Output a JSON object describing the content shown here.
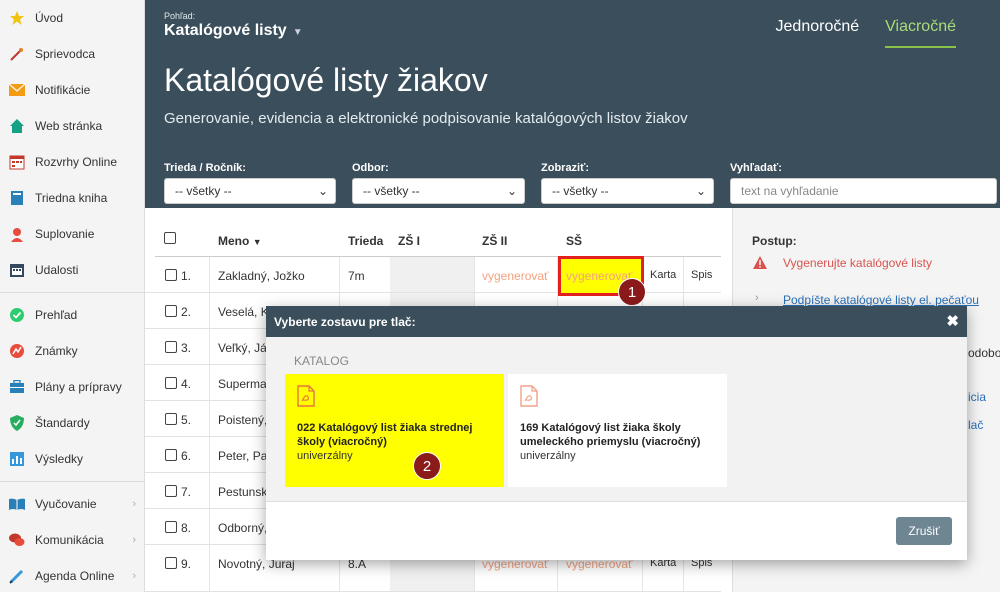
{
  "sidebar": {
    "items": [
      {
        "label": "Úvod",
        "icon": "star-icon"
      },
      {
        "label": "Sprievodca",
        "icon": "magic-wand-icon"
      },
      {
        "label": "Notifikácie",
        "icon": "envelope-icon"
      },
      {
        "label": "Web stránka",
        "icon": "house-icon"
      },
      {
        "label": "Rozvrhy Online",
        "icon": "calendar-grid-icon"
      },
      {
        "label": "Triedna kniha",
        "icon": "book-icon"
      },
      {
        "label": "Suplovanie",
        "icon": "user-icon"
      },
      {
        "label": "Udalosti",
        "icon": "calendar-icon"
      },
      {
        "label": "Prehľad",
        "icon": "check-circle-icon"
      },
      {
        "label": "Známky",
        "icon": "chart-circle-icon"
      },
      {
        "label": "Plány a prípravy",
        "icon": "briefcase-icon"
      },
      {
        "label": "Štandardy",
        "icon": "shield-icon"
      },
      {
        "label": "Výsledky",
        "icon": "bar-chart-icon"
      },
      {
        "label": "Vyučovanie",
        "icon": "open-book-icon"
      },
      {
        "label": "Komunikácia",
        "icon": "chat-bubbles-icon"
      },
      {
        "label": "Agenda Online",
        "icon": "pen-icon"
      }
    ]
  },
  "header": {
    "view_label": "Pohľad:",
    "view_value": "Katalógové listy",
    "tabs": [
      "Jednoročné",
      "Viacročné"
    ],
    "active_tab": "Viacročné",
    "title": "Katalógové listy žiakov",
    "subtitle": "Generovanie, evidencia a elektronické podpisovanie katalógových listov žiakov"
  },
  "filters": {
    "trieda": {
      "label": "Trieda / Ročník:",
      "value": "-- všetky --"
    },
    "odbor": {
      "label": "Odbor:",
      "value": "-- všetky --"
    },
    "zobrazit": {
      "label": "Zobraziť:",
      "value": "-- všetky --"
    },
    "vyhladat": {
      "label": "Vyhľadať:",
      "placeholder": "text na vyhľadanie"
    }
  },
  "table": {
    "columns": {
      "meno": "Meno",
      "trieda": "Trieda",
      "zs1": "ZŠ I",
      "zs2": "ZŠ II",
      "ss": "SŠ"
    },
    "rows": [
      {
        "num": "1.",
        "meno": "Zakladný, Jožko",
        "trieda": "7m",
        "zs2": "vygenerovať",
        "ss": "vygenerovať",
        "karta": "Karta",
        "spis": "Spis"
      },
      {
        "num": "2.",
        "meno": "Veselá, K",
        "trieda": "",
        "zs2": "",
        "ss": "",
        "karta": "",
        "spis": ""
      },
      {
        "num": "3.",
        "meno": "Veľký, Já",
        "trieda": "",
        "zs2": "",
        "ss": "",
        "karta": "",
        "spis": ""
      },
      {
        "num": "4.",
        "meno": "Superma",
        "trieda": "",
        "zs2": "",
        "ss": "",
        "karta": "",
        "spis": ""
      },
      {
        "num": "5.",
        "meno": "Poistený,",
        "trieda": "",
        "zs2": "",
        "ss": "",
        "karta": "",
        "spis": ""
      },
      {
        "num": "6.",
        "meno": "Peter, Pa",
        "trieda": "",
        "zs2": "",
        "ss": "",
        "karta": "",
        "spis": ""
      },
      {
        "num": "7.",
        "meno": "Pestunsk",
        "trieda": "",
        "zs2": "",
        "ss": "",
        "karta": "",
        "spis": ""
      },
      {
        "num": "8.",
        "meno": "Odborný,",
        "trieda": "",
        "zs2": "",
        "ss": "",
        "karta": "",
        "spis": ""
      },
      {
        "num": "9.",
        "meno": "Novotný, Juraj",
        "trieda": "8.A",
        "zs2": "vygenerovať",
        "ss": "vygenerovať",
        "karta": "Karta",
        "spis": "Spis"
      }
    ]
  },
  "panel": {
    "postup": "Postup:",
    "step1": "Vygenerujte katalógové listy",
    "step2": "Podpíšte katalógové listy el. pečaťou",
    "peek_1": "odobo",
    "peek_2": "icia",
    "peek_3": "lač"
  },
  "modal": {
    "title": "Vyberte zostavu pre tlač:",
    "close": "✖",
    "category": "KATALOG",
    "cards": [
      {
        "title": "022 Katalógový list žiaka strednej školy (viacročný)",
        "subtitle": "univerzálny"
      },
      {
        "title": "169 Katalógový list žiaka školy umeleckého priemyslu (viacročný)",
        "subtitle": "univerzálny"
      }
    ],
    "cancel": "Zrušiť"
  },
  "badges": {
    "one": "1",
    "two": "2"
  },
  "colors": {
    "header_bg": "#3b4e5c",
    "active_tab": "#a7dc7a",
    "highlight": "#ffff00",
    "outline_red": "#e32020",
    "badge": "#8b1a1a",
    "vygenerovat": "#f3a282",
    "link": "#2a70b8"
  }
}
